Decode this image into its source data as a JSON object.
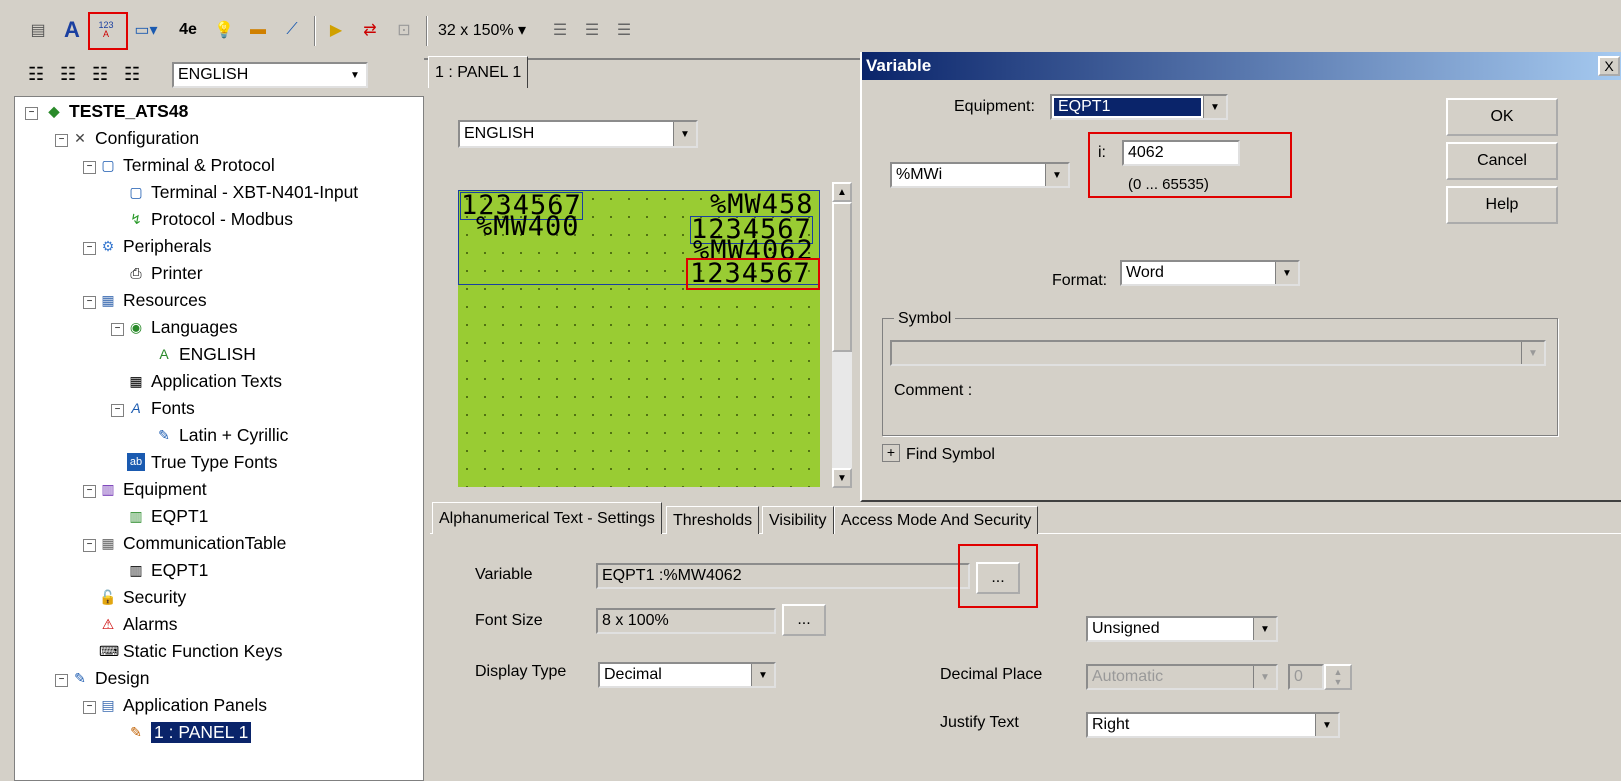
{
  "toolbar": {
    "zoom_label": "32 x 150%",
    "icons": [
      "panel-icon",
      "text-icon",
      "numeric-display-icon",
      "image-icon",
      "font-icon",
      "bulb-icon",
      "bar-graph-icon",
      "trend-icon",
      "play-icon",
      "transfer-icon",
      "disabled-icon",
      "align-left-icon",
      "align-center-icon",
      "align-right-icon"
    ]
  },
  "tree_toolbar": {
    "language": "ENGLISH"
  },
  "tree": {
    "root": "TESTE_ATS48",
    "configuration": "Configuration",
    "terminal_protocol": "Terminal & Protocol",
    "terminal": "Terminal - XBT-N401-Input",
    "protocol": "Protocol - Modbus",
    "peripherals": "Peripherals",
    "printer": "Printer",
    "resources": "Resources",
    "languages": "Languages",
    "english": "ENGLISH",
    "app_texts": "Application Texts",
    "fonts": "Fonts",
    "latin": "Latin + Cyrillic",
    "ttf": "True Type Fonts",
    "equipment": "Equipment",
    "eqpt1": "EQPT1",
    "comm_table": "CommunicationTable",
    "comm_eqpt1": "EQPT1",
    "security": "Security",
    "alarms": "Alarms",
    "static_keys": "Static Function Keys",
    "design": "Design",
    "app_panels": "Application Panels",
    "panel1": "1 : PANEL 1"
  },
  "panel": {
    "tab": "1 : PANEL 1",
    "language": "ENGLISH",
    "lcd": {
      "line1_left": "1234567",
      "line1_right": "%MW458",
      "line2_left": "%MW400",
      "line2_right": "1234567",
      "line3_right": "%MW4062",
      "line4_right": "1234567"
    }
  },
  "variable_dialog": {
    "title": "Variable",
    "close": "X",
    "equipment_label": "Equipment:",
    "equipment_value": "EQPT1",
    "type_value": "%MWi",
    "i_label": "i:",
    "i_value": "4062",
    "range": "(0 ... 65535)",
    "format_label": "Format:",
    "format_value": "Word",
    "symbol_group": "Symbol",
    "comment_label": "Comment :",
    "find_symbol": "Find Symbol",
    "find_symbol_toggle": "+",
    "ok": "OK",
    "cancel": "Cancel",
    "help": "Help"
  },
  "settings": {
    "tabs": [
      "Alphanumerical Text - Settings",
      "Thresholds",
      "Visibility",
      "Access Mode And Security"
    ],
    "variable_label": "Variable",
    "variable_value": "EQPT1 :%MW4062",
    "browse": "...",
    "font_size_label": "Font Size",
    "font_size_value": "8 x 100%",
    "font_browse": "...",
    "display_type_label": "Display Type",
    "display_type_value": "Decimal",
    "sign_value": "Unsigned",
    "decimal_place_label": "Decimal Place",
    "decimal_place_value": "Automatic",
    "decimal_count": "0",
    "justify_label": "Justify Text",
    "justify_value": "Right"
  },
  "colors": {
    "highlight": "#e00000",
    "lcd": "#99cc33",
    "selection": "#0a246a"
  }
}
